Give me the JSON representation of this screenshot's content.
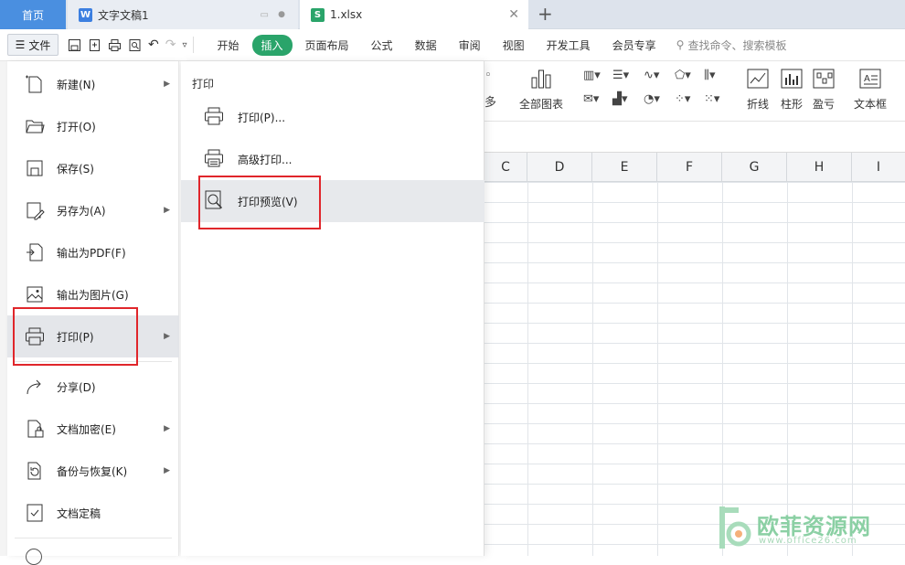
{
  "tabs": [
    {
      "label": "首页"
    },
    {
      "label": "文字文稿1"
    },
    {
      "label": "1.xlsx"
    }
  ],
  "file_button": {
    "label": "文件"
  },
  "ribbon_tabs": [
    "开始",
    "插入",
    "页面布局",
    "公式",
    "数据",
    "审阅",
    "视图",
    "开发工具",
    "会员专享"
  ],
  "search": {
    "placeholder": "查找命令、搜索模板"
  },
  "toolbar": {
    "all_charts": "全部图表",
    "line": "折线",
    "column": "柱形",
    "winloss": "盈亏",
    "textbox": "文本框",
    "more_partial": "多"
  },
  "columns": [
    "C",
    "D",
    "E",
    "F",
    "G",
    "H",
    "I"
  ],
  "file_menu": {
    "items": [
      {
        "label": "新建(N)",
        "has_submenu": true
      },
      {
        "label": "打开(O)",
        "has_submenu": false
      },
      {
        "label": "保存(S)",
        "has_submenu": false
      },
      {
        "label": "另存为(A)",
        "has_submenu": true
      },
      {
        "label": "输出为PDF(F)",
        "has_submenu": false
      },
      {
        "label": "输出为图片(G)",
        "has_submenu": false
      },
      {
        "label": "打印(P)",
        "has_submenu": true
      },
      {
        "label": "分享(D)",
        "has_submenu": false
      },
      {
        "label": "文档加密(E)",
        "has_submenu": true
      },
      {
        "label": "备份与恢复(K)",
        "has_submenu": true
      },
      {
        "label": "文档定稿",
        "has_submenu": false
      }
    ]
  },
  "print_submenu": {
    "title": "打印",
    "items": [
      {
        "label": "打印(P)..."
      },
      {
        "label": "高级打印..."
      },
      {
        "label": "打印预览(V)"
      }
    ]
  },
  "watermark": {
    "text": "欧菲资源网",
    "url": "www.office26.com"
  },
  "colors": {
    "accent_green": "#2aa46a",
    "home_tab": "#4a8fe0",
    "highlight_red": "#e0262b"
  }
}
